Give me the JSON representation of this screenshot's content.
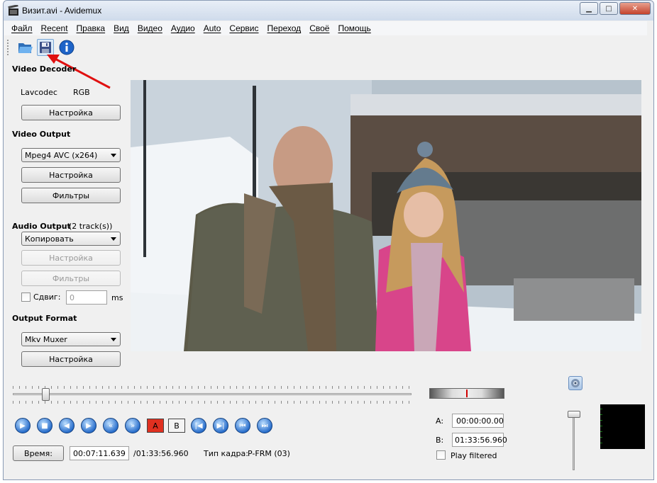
{
  "window": {
    "title": "Визит.avi - Avidemux"
  },
  "menu": [
    "Файл",
    "Recent",
    "Правка",
    "Вид",
    "Видео",
    "Аудио",
    "Auto",
    "Сервис",
    "Переход",
    "Своё",
    "Помощь"
  ],
  "video_decoder": {
    "heading": "Video Decoder",
    "codec": "Lavcodec",
    "format": "RGB",
    "configure": "Настройка"
  },
  "video_output": {
    "heading": "Video Output",
    "codec": "Mpeg4 AVC (x264)",
    "configure": "Настройка",
    "filters": "Фильтры"
  },
  "audio_output": {
    "heading": "Audio Output",
    "tracks": "(2 track(s))",
    "codec": "Копировать",
    "configure": "Настройка",
    "filters": "Фильтры",
    "shift_label": "Сдвиг:",
    "shift_value": "0",
    "shift_unit": "ms"
  },
  "output_format": {
    "heading": "Output Format",
    "muxer": "Mkv Muxer",
    "configure": "Настройка"
  },
  "controls": {
    "mark_a": "A",
    "mark_b": "B"
  },
  "time": {
    "button": "Время:",
    "current": "00:07:11.639",
    "total": "/01:33:56.960",
    "frame_type_label": "Тип кадра:",
    "frame_type": "P-FRM (03)"
  },
  "selection": {
    "a_label": "A:",
    "a_value": "00:00:00.00",
    "b_label": "B:",
    "b_value": "01:33:56.960",
    "play_filtered": "Play filtered"
  },
  "icons": {
    "open": "folder-open-icon",
    "save": "floppy-save-icon",
    "info": "info-icon"
  }
}
